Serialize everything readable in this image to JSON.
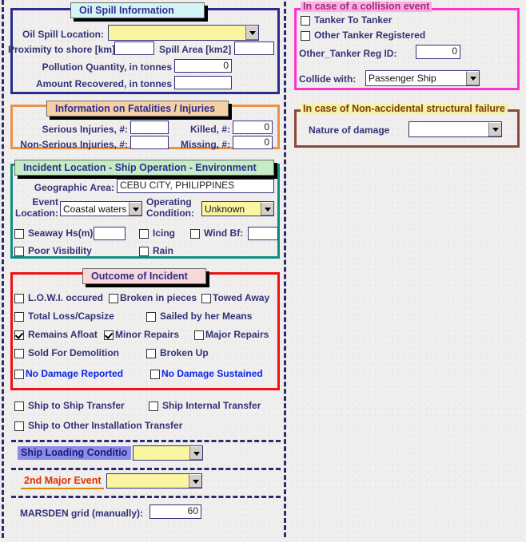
{
  "colors": {
    "label_text": "#333377",
    "accent_blue": "#0a24e8",
    "panel_oilspill_border": "#2b2b8f",
    "panel_fatalities_border": "#e8924a",
    "panel_incident_border": "#0f8f82",
    "panel_outcome_border": "#ee1111",
    "panel_collision_border": "#ff33cc",
    "panel_structural_border": "#8a4a3a",
    "caption_oilspill_bg": "#d4f5f5",
    "caption_fatalities_bg": "#f6cfa4",
    "caption_incident_bg": "#c6ecc6",
    "caption_outcome_bg": "#f8d7d7",
    "legend_collision_bg": "#ffaaee",
    "legend_structural_bg": "#f7f39a",
    "field_yellow": "#f9f5a0",
    "chip_loading_bg": "#8c8ce0",
    "chip_event_text": "#dd3300"
  },
  "oil_spill": {
    "caption": "Oil Spill Information",
    "location_label": "Oil Spill Location:",
    "location_value": "",
    "proximity_label": "Proximity to shore [km]:",
    "proximity_value": "",
    "spill_area_label": "Spill Area [km2]",
    "spill_area_value": "",
    "pollution_label": "Pollution Quantity, in tonnes",
    "pollution_value": "0",
    "recovered_label": "Amount Recovered, in tonnes",
    "recovered_value": ""
  },
  "fatalities": {
    "caption": "Information on Fatalities / Injuries",
    "serious_label": "Serious Injuries, #:",
    "serious_value": "",
    "killed_label": "Killed, #:",
    "killed_value": "0",
    "nonserious_label": "Non-Serious Injuries, #:",
    "nonserious_value": "",
    "missing_label": "Missing, #:",
    "missing_value": "0"
  },
  "incident": {
    "caption": "Incident Location - Ship Operation - Environment",
    "geographic_label": "Geographic Area:",
    "geographic_value": "CEBU CITY, PHILIPPINES",
    "event_location_label_line1": "Event",
    "event_location_label_line2": "Location:",
    "event_location_value": "Coastal waters",
    "operating_condition_label_line1": "Operating",
    "operating_condition_label_line2": "Condition:",
    "operating_condition_value": "Unknown",
    "seaway_label": "Seaway  Hs(m)",
    "seaway_checked": false,
    "seaway_value": "",
    "icing_label": "Icing",
    "icing_checked": false,
    "wind_label": "Wind  Bf:",
    "wind_checked": false,
    "wind_value": "",
    "poor_visibility_label": "Poor Visibility",
    "poor_visibility_checked": false,
    "rain_label": "Rain",
    "rain_checked": false
  },
  "outcome": {
    "caption": "Outcome of Incident",
    "items": [
      {
        "label": "L.O.W.I. occured",
        "checked": false,
        "accent": false
      },
      {
        "label": "Broken in pieces",
        "checked": false,
        "accent": false
      },
      {
        "label": "Towed Away",
        "checked": false,
        "accent": false
      },
      {
        "label": "Total Loss/Capsize",
        "checked": false,
        "accent": false
      },
      {
        "label": "Sailed by her Means",
        "checked": false,
        "accent": false
      },
      {
        "label": "Remains Afloat",
        "checked": true,
        "accent": false
      },
      {
        "label": "Minor Repairs",
        "checked": true,
        "accent": false
      },
      {
        "label": "Major Repairs",
        "checked": false,
        "accent": false
      },
      {
        "label": "Sold For Demolition",
        "checked": false,
        "accent": false
      },
      {
        "label": "Broken Up",
        "checked": false,
        "accent": false
      },
      {
        "label": "No Damage Reported",
        "checked": false,
        "accent": true
      },
      {
        "label": "No Damage Sustained",
        "checked": false,
        "accent": true
      }
    ]
  },
  "transfer": {
    "ship_to_ship_label": "Ship to Ship Transfer",
    "ship_to_ship_checked": false,
    "ship_internal_label": "Ship Internal Transfer",
    "ship_internal_checked": false,
    "ship_other_label": "Ship to Other Installation Transfer",
    "ship_other_checked": false
  },
  "bottom": {
    "loading_condition_label": "Ship Loading Conditio",
    "loading_condition_value": "",
    "second_major_event_label": "2nd Major Event",
    "second_major_event_value": "",
    "marsden_label": "MARSDEN grid (manually):",
    "marsden_value": "60"
  },
  "collision": {
    "legend": "In case of a collision event",
    "tanker_to_tanker_label": "Tanker To Tanker",
    "tanker_to_tanker_checked": false,
    "other_tanker_registered_label": "Other Tanker Registered",
    "other_tanker_registered_checked": false,
    "other_tanker_reg_id_label": "Other_Tanker Reg ID:",
    "other_tanker_reg_id_value": "0",
    "collide_with_label": "Collide with:",
    "collide_with_value": "Passenger Ship"
  },
  "structural": {
    "legend": "In case of Non-accidental structural failure",
    "nature_label": "Nature of damage",
    "nature_value": ""
  }
}
